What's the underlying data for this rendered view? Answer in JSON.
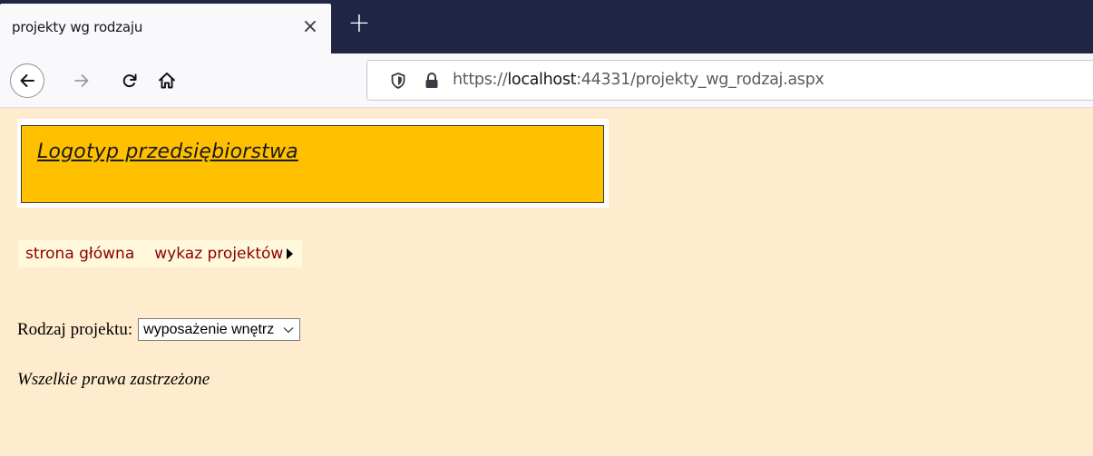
{
  "browser": {
    "tab_title": "projekty wg rodzaju",
    "tab_close_glyph": "×",
    "new_tab_glyph": "+",
    "url_scheme": "https://",
    "url_host": "localhost",
    "url_rest": ":44331/projekty_wg_rodzaj.aspx",
    "icons": [
      "back-arrow-icon",
      "forward-arrow-icon",
      "reload-icon",
      "home-icon",
      "shield-icon",
      "lock-icon"
    ]
  },
  "header": {
    "logo_text": "Logotyp przedsiębiorstwa"
  },
  "menu": {
    "items": [
      {
        "label": "strona główna"
      },
      {
        "label": "wykaz projektów"
      }
    ]
  },
  "form": {
    "label": "Rodzaj projektu:",
    "select_value": "wyposażenie wnętrz"
  },
  "footer": {
    "text": "Wszelkie prawa zastrzeżone"
  },
  "colors": {
    "page_background": "#ffebcd",
    "logo_background": "#ffc000",
    "menu_background": "#fff8dc",
    "menu_text": "#8b0000",
    "tabstrip_background": "#1f2544"
  }
}
